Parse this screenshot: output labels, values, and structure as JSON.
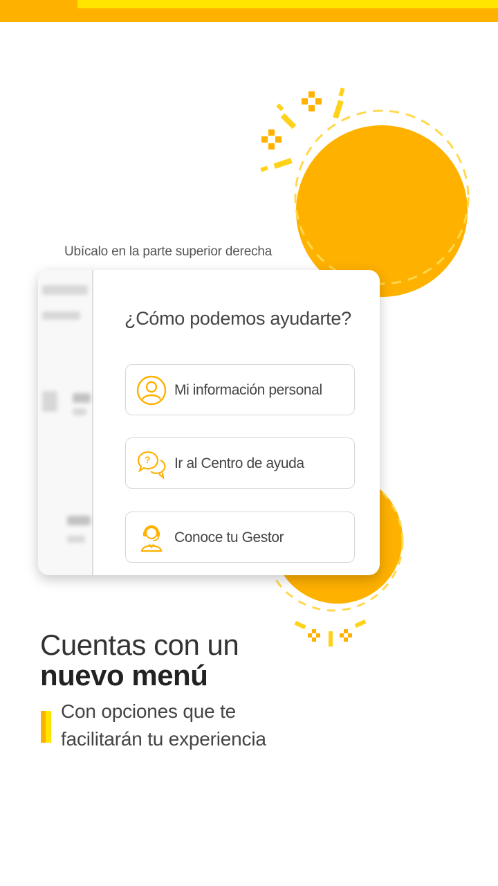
{
  "colors": {
    "primary_yellow": "#FFB100",
    "accent_yellow": "#FFE600",
    "text": "#333333"
  },
  "hint_text": "Ubícalo en la parte superior derecha",
  "menu": {
    "title": "¿Cómo podemos ayudarte?",
    "items": [
      {
        "label": "Mi información personal",
        "icon": "user-icon"
      },
      {
        "label": "Ir al Centro de ayuda",
        "icon": "help-chat-icon"
      },
      {
        "label": "Conoce tu Gestor",
        "icon": "agent-icon"
      }
    ]
  },
  "headline": {
    "line1": "Cuentas con un",
    "line2": "nuevo menú"
  },
  "subtitle": {
    "line1": "Con opciones que te",
    "line2": "facilitarán tu experiencia"
  }
}
